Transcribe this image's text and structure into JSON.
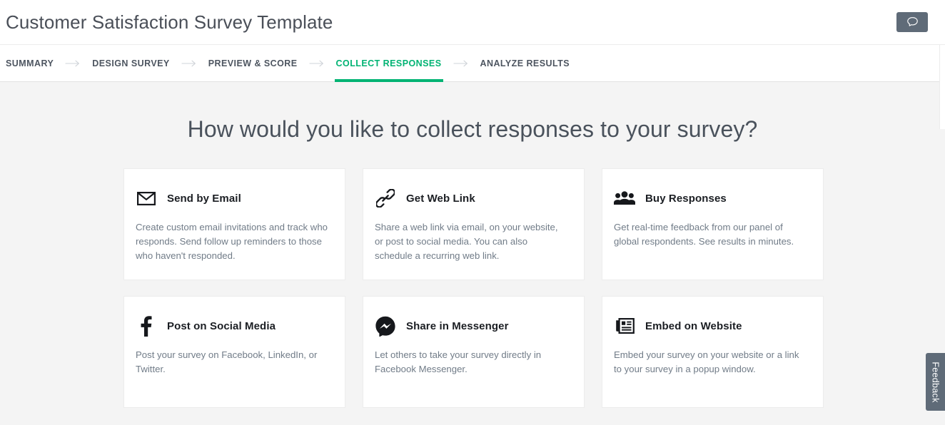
{
  "header": {
    "title": "Customer Satisfaction Survey Template",
    "chat_icon": "speech-bubble-icon",
    "chat_button_color": "#5f6b78"
  },
  "stepnav": {
    "active_color": "#00b373",
    "separator_icon": "arrow-right-icon",
    "steps": [
      {
        "label": "SUMMARY",
        "active": false
      },
      {
        "label": "DESIGN SURVEY",
        "active": false
      },
      {
        "label": "PREVIEW & SCORE",
        "active": false
      },
      {
        "label": "COLLECT RESPONSES",
        "active": true
      },
      {
        "label": "ANALYZE RESULTS",
        "active": false
      }
    ]
  },
  "main": {
    "headline": "How would you like to collect responses to your survey?",
    "cards": [
      {
        "icon": "envelope-icon",
        "title": "Send by Email",
        "description": "Create custom email invitations and track who responds. Send follow up reminders to those who haven't responded."
      },
      {
        "icon": "chain-link-icon",
        "title": "Get Web Link",
        "description": "Share a web link via email, on your website, or post to social media. You can also schedule a recurring web link."
      },
      {
        "icon": "people-group-icon",
        "title": "Buy Responses",
        "description": "Get real-time feedback from our panel of global respondents. See results in minutes."
      },
      {
        "icon": "facebook-f-icon",
        "title": "Post on Social Media",
        "description": "Post your survey on Facebook, LinkedIn, or Twitter."
      },
      {
        "icon": "messenger-icon",
        "title": "Share in Messenger",
        "description": "Let others to take your survey directly in Facebook Messenger."
      },
      {
        "icon": "embed-document-icon",
        "title": "Embed on Website",
        "description": "Embed your survey on your website or a link to your survey in a popup window."
      }
    ]
  },
  "feedback": {
    "label": "Feedback",
    "color": "#5f6b78"
  }
}
